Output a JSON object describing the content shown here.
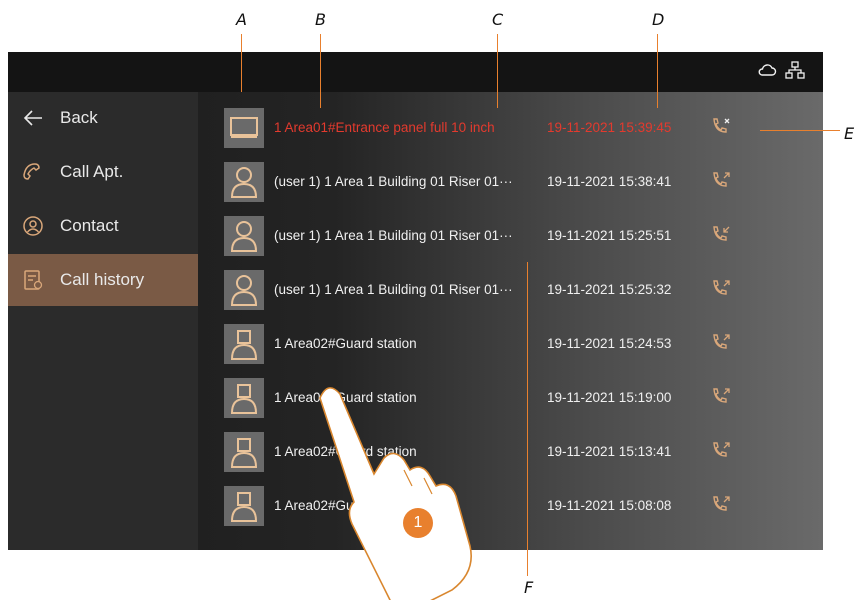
{
  "callouts": {
    "a": "A",
    "b": "B",
    "c": "C",
    "d": "D",
    "e": "E",
    "f": "F"
  },
  "sidebar": {
    "items": [
      {
        "label": "Back",
        "icon": "arrow-left-icon"
      },
      {
        "label": "Call Apt.",
        "icon": "handset-icon"
      },
      {
        "label": "Contact",
        "icon": "person-circle-icon"
      },
      {
        "label": "Call history",
        "icon": "history-list-icon",
        "active": true
      }
    ]
  },
  "status_icons": [
    "cloud-icon",
    "network-icon"
  ],
  "history": [
    {
      "name": "1 Area01#Entrance panel full 10 inch",
      "time": "19-11-2021 15:39:45",
      "avatar": "panel-icon",
      "call": "missed-call-icon",
      "missed": true
    },
    {
      "name": "(user 1) 1 Area 1 Building 01 Riser 01···",
      "time": "19-11-2021 15:38:41",
      "avatar": "user-icon",
      "call": "outgoing-call-icon"
    },
    {
      "name": "(user 1) 1 Area 1 Building 01 Riser 01···",
      "time": "19-11-2021 15:25:51",
      "avatar": "user-icon",
      "call": "incoming-call-icon"
    },
    {
      "name": "(user 1) 1 Area 1 Building 01 Riser 01···",
      "time": "19-11-2021 15:25:32",
      "avatar": "user-icon",
      "call": "outgoing-call-icon"
    },
    {
      "name": "1 Area02#Guard station",
      "time": "19-11-2021 15:24:53",
      "avatar": "guard-icon",
      "call": "outgoing-call-icon"
    },
    {
      "name": "1 Area02#Guard station",
      "time": "19-11-2021 15:19:00",
      "avatar": "guard-icon",
      "call": "outgoing-call-icon"
    },
    {
      "name": "1 Area02#Guard station",
      "time": "19-11-2021 15:13:41",
      "avatar": "guard-icon",
      "call": "outgoing-call-icon"
    },
    {
      "name": "1 Area02#Guard station",
      "time": "19-11-2021 15:08:08",
      "avatar": "guard-icon",
      "call": "outgoing-call-icon"
    }
  ],
  "step_badge": "1",
  "colors": {
    "accent": "#e8802e",
    "missed": "#e33a2e",
    "active_tab": "#7a5a45",
    "icon": "#d9a77a"
  }
}
